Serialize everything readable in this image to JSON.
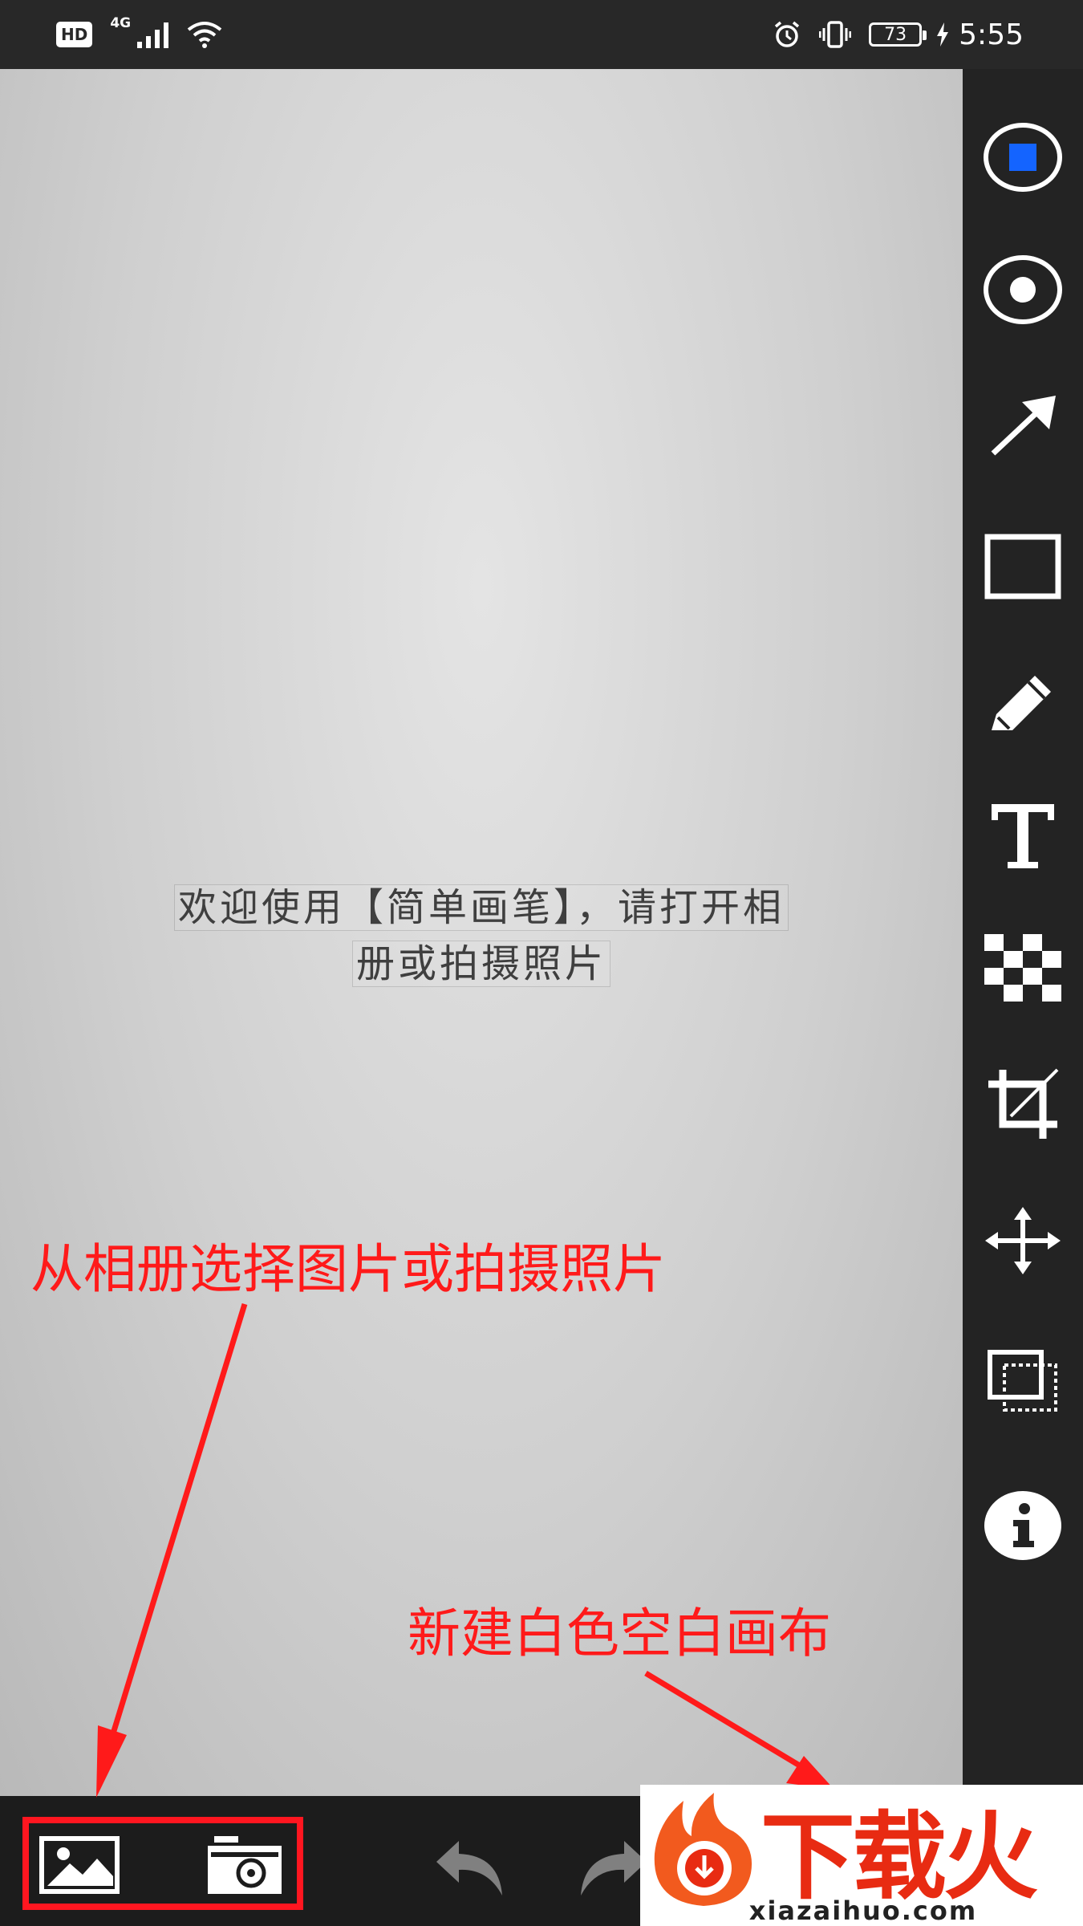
{
  "status_bar": {
    "hd_badge": "HD",
    "network": "4G",
    "battery": "73",
    "time": "5:55",
    "icons": [
      "signal-icon",
      "wifi-icon",
      "alarm-icon",
      "vibrate-icon",
      "battery-icon",
      "charging-icon"
    ]
  },
  "canvas": {
    "welcome_line1": "欢迎使用【简单画笔】，请打开相",
    "welcome_line2": "册或拍摄照片"
  },
  "toolbar": {
    "active_color": "#1464ff",
    "tools": [
      "color-picker-icon",
      "stroke-size-icon",
      "arrow-icon",
      "rectangle-icon",
      "pencil-icon",
      "text-icon",
      "mosaic-icon",
      "crop-icon",
      "move-icon",
      "layers-icon",
      "info-icon"
    ]
  },
  "bottom_bar": {
    "buttons": [
      "gallery-icon",
      "camera-icon",
      "undo-icon",
      "redo-icon",
      "new-canvas-icon",
      "save-icon"
    ]
  },
  "annotations": {
    "gallery_hint": "从相册选择图片或拍摄照片",
    "blank_canvas_hint": "新建白色空白画布",
    "color": "#ff1a1a"
  },
  "watermark": {
    "brand": "下载火",
    "domain": "xiazaihuo.com"
  }
}
